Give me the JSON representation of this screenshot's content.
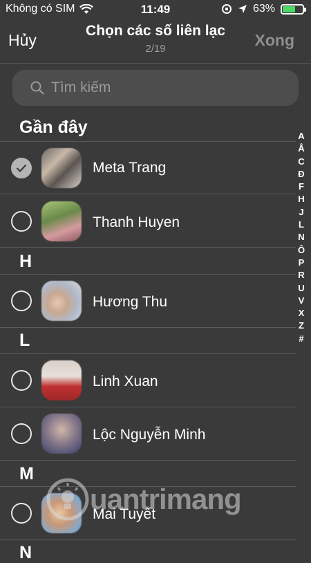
{
  "status": {
    "carrier": "Không có SIM",
    "time": "11:49",
    "battery_pct": "63%",
    "battery_level": 0.63
  },
  "nav": {
    "cancel": "Hủy",
    "title": "Chọn các số liên lạc",
    "count": "2/19",
    "done": "Xong"
  },
  "search": {
    "placeholder": "Tìm kiếm"
  },
  "sections": [
    {
      "header": "Gần đây",
      "contacts": [
        {
          "name": "Meta Trang",
          "selected": true
        },
        {
          "name": "Thanh Huyen",
          "selected": false
        }
      ]
    },
    {
      "header": "H",
      "contacts": [
        {
          "name": "Hương Thu",
          "selected": false
        }
      ]
    },
    {
      "header": "L",
      "contacts": [
        {
          "name": "Linh Xuan",
          "selected": false
        },
        {
          "name": "Lộc Nguyễn Minh",
          "selected": false
        }
      ]
    },
    {
      "header": "M",
      "contacts": [
        {
          "name": "Mai Tuyết",
          "selected": false
        }
      ]
    },
    {
      "header": "N",
      "contacts": []
    }
  ],
  "index_letters": [
    "A",
    "Â",
    "C",
    "Đ",
    "F",
    "H",
    "J",
    "L",
    "N",
    "Ô",
    "P",
    "R",
    "U",
    "V",
    "X",
    "Z",
    "#"
  ],
  "watermark": "uantrimang"
}
